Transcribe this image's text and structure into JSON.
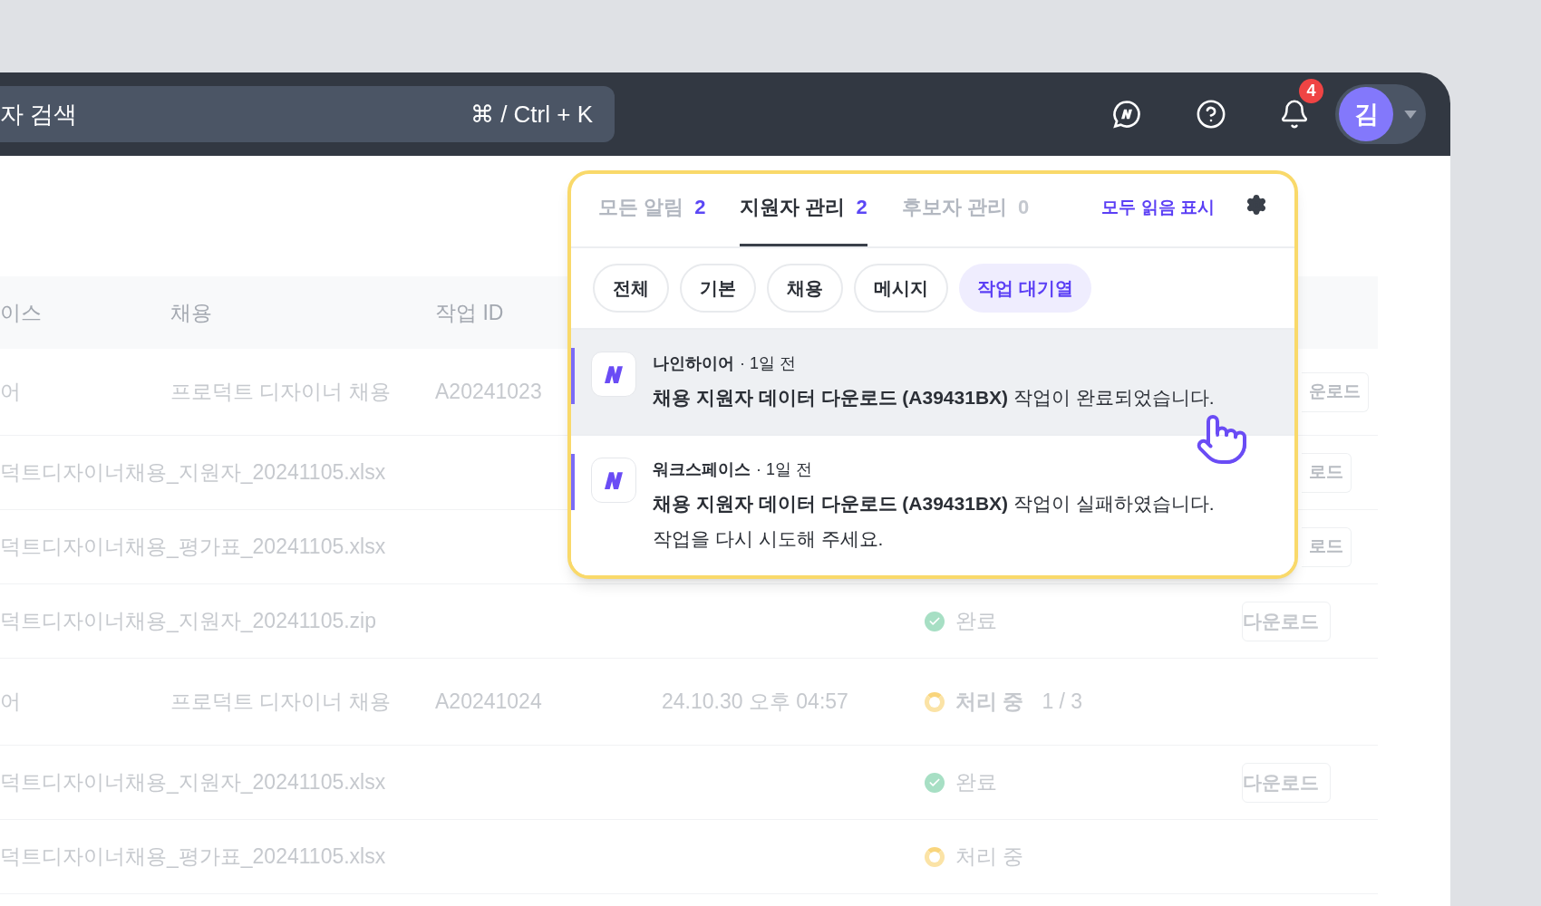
{
  "header": {
    "search": {
      "placeholder": "자 검색",
      "shortcut": "⌘ / Ctrl + K"
    },
    "notification_count": "4",
    "avatar": "김"
  },
  "table": {
    "columns": [
      "이스",
      "채용",
      "작업 ID"
    ],
    "rows": [
      {
        "kind": "group",
        "workspace": "어",
        "recruit": "프로덕트 디자이너 채용",
        "job_id": "A20241023",
        "button": "운로드",
        "button_cut": true
      },
      {
        "kind": "file",
        "name": "덕트디자이너채용_지원자_20241105.xlsx",
        "button": "로드",
        "button_cut": true
      },
      {
        "kind": "file",
        "name": "덕트디자이너채용_평가표_20241105.xlsx",
        "button": "로드",
        "button_cut": true
      },
      {
        "kind": "file",
        "name": "덕트디자이너채용_지원자_20241105.zip",
        "status": {
          "kind": "done",
          "label": "완료"
        },
        "button": "다운로드",
        "button_cut": false
      },
      {
        "kind": "group",
        "workspace": "어",
        "recruit": "프로덕트 디자이너 채용",
        "job_id": "A20241024",
        "date": "24.10.30 오후 04:57",
        "status": {
          "kind": "processing",
          "label": "처리 중",
          "progress": "1 / 3"
        }
      },
      {
        "kind": "file",
        "name": "덕트디자이너채용_지원자_20241105.xlsx",
        "status": {
          "kind": "done",
          "label": "완료"
        },
        "button": "다운로드",
        "button_cut": false
      },
      {
        "kind": "file",
        "name": "덕트디자이너채용_평가표_20241105.xlsx",
        "status": {
          "kind": "processing",
          "label": "처리 중"
        }
      }
    ]
  },
  "popup": {
    "tabs": [
      {
        "label": "모든 알림",
        "count": "2",
        "selected": false
      },
      {
        "label": "지원자 관리",
        "count": "2",
        "selected": true
      },
      {
        "label": "후보자 관리",
        "count": "0",
        "selected": false
      }
    ],
    "mark_all_read": "모두 읽음 표시",
    "filters": [
      {
        "label": "전체",
        "selected": false
      },
      {
        "label": "기본",
        "selected": false
      },
      {
        "label": "채용",
        "selected": false
      },
      {
        "label": "메시지",
        "selected": false
      },
      {
        "label": "작업 대기열",
        "selected": true
      }
    ],
    "notifications": [
      {
        "source": "나인하이어",
        "time": "· 1일 전",
        "unread": true,
        "hovered": true,
        "lines": [
          "**채용 지원자 데이터 다운로드 (A39431BX)** 작업이 완료되었습니다."
        ]
      },
      {
        "source": "워크스페이스",
        "time": "· 1일 전",
        "unread": true,
        "hovered": false,
        "lines": [
          "**채용 지원자 데이터 다운로드 (A39431BX)** 작업이 실패하였습니다.",
          "작업을 다시 시도해 주세요."
        ]
      }
    ]
  }
}
